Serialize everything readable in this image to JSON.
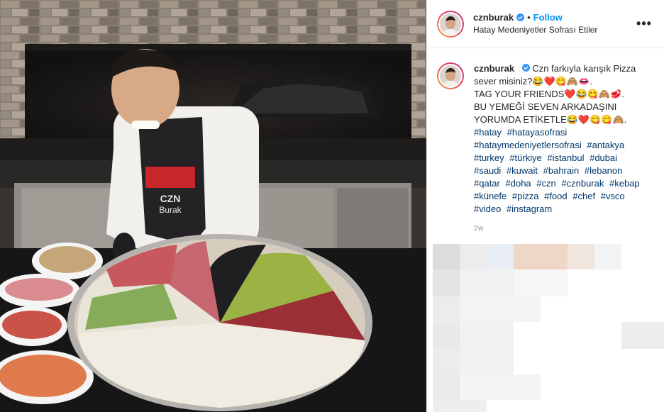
{
  "post": {
    "username": "cznburak",
    "follow_label": "Follow",
    "location": "Hatay Medeniyetler Sofrası Etiler",
    "more_icon": "•••"
  },
  "caption": {
    "username": "cznburak",
    "line1": "Czn farkıyla karışık Pizza sever misiniz?😂❤️😋🙈👄.",
    "line2": "TAG YOUR FRIENDS❤️😂😋🙈🥩.",
    "line3": "BU YEMEĞİ SEVEN ARKADAŞINI YORUMDA ETİKETLE😂❤️😋😋🙈.",
    "hashtags": [
      "#hatay",
      "#hatayasofrasi",
      "#hataymedeniyetlersofrasi",
      "#antakya",
      "#turkey",
      "#türkiye",
      "#istanbul",
      "#dubai",
      "#saudi",
      "#kuwait",
      "#bahrain",
      "#lebanon",
      "#qatar",
      "#doha",
      "#czn",
      "#cznburak",
      "#kebap",
      "#künefe",
      "#pizza",
      "#food",
      "#chef",
      "#vsco",
      "#video",
      "#instagram"
    ],
    "time": "2w"
  },
  "colors": {
    "accent": "#0095f6",
    "hashtag": "#00376b"
  }
}
